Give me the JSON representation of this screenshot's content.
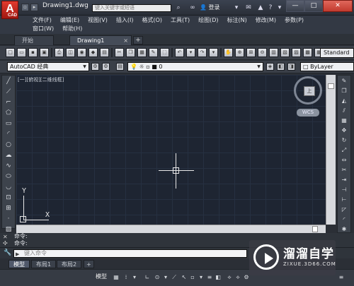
{
  "title_bar": {
    "logo_letter": "A",
    "logo_sub": "CAD",
    "document_title": "Drawing1.dwg",
    "search_placeholder": "键入关键字或短语",
    "login_label": "登录",
    "minimize": "—",
    "restore": "□",
    "close": "✕"
  },
  "menu": {
    "row1": [
      "文件(F)",
      "编辑(E)",
      "视图(V)",
      "插入(I)",
      "格式(O)",
      "工具(T)",
      "绘图(D)",
      "标注(N)",
      "修改(M)",
      "参数(P)"
    ],
    "row2": [
      "窗口(W)",
      "帮助(H)"
    ]
  },
  "doc_tabs": {
    "start": "开始",
    "active": "Drawing1",
    "close": "×",
    "add": "+"
  },
  "toolbar": {
    "standard_label": "Standard"
  },
  "properties_bar": {
    "workspace": "AutoCAD 经典",
    "layer": "0",
    "color": "ByLayer"
  },
  "canvas": {
    "viewport_label": "[一][俯视][二维线框]",
    "ucs_x": "X",
    "ucs_y": "Y",
    "viewcube_face": "上",
    "wcs_label": "WCS"
  },
  "command": {
    "history": [
      "命令:",
      "命令:"
    ],
    "input_prefix": "▶",
    "input_placeholder": "键入命令"
  },
  "layout_tabs": [
    "模型",
    "布局1",
    "布局2"
  ],
  "status_bar": {
    "model_label": "模型"
  },
  "watermark": {
    "title": "溜溜自学",
    "url": "ZIXUE.3D66.COM"
  },
  "colors": {
    "canvas_bg": "#1e2532",
    "logo_red": "#c82a1f"
  }
}
